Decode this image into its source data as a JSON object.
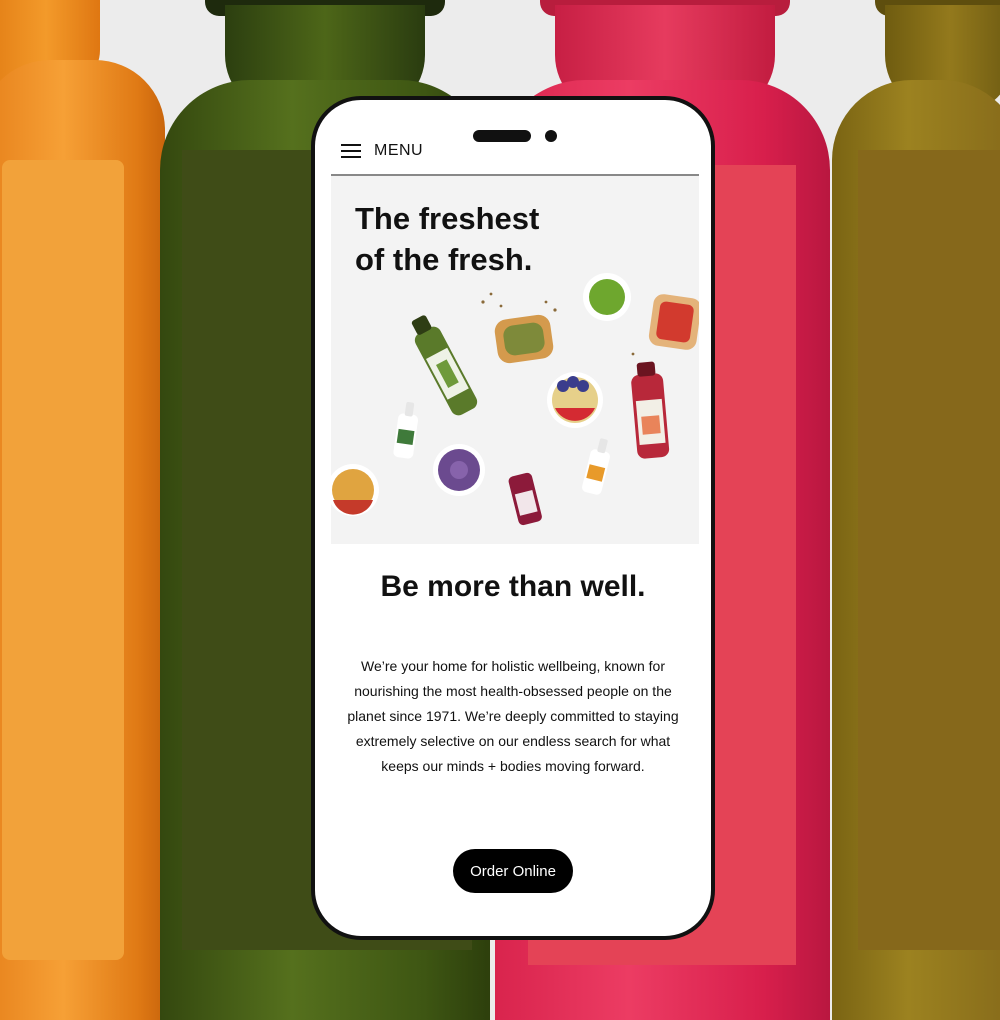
{
  "background": {
    "bottle_colors": [
      "#f39a2a",
      "#4d6618",
      "#e63b5e",
      "#93791c"
    ]
  },
  "header": {
    "menu_icon": "hamburger-icon",
    "menu_label": "MENU"
  },
  "hero": {
    "title_line1": "The freshest",
    "title_line2": "of the fresh.",
    "image_items": [
      "juice-bottle",
      "avocado-toast",
      "green-bowl",
      "strawberry-toast",
      "acai-bowl",
      "juice-bottle",
      "dropper-bottle",
      "smoothie-bowl",
      "juice-shot",
      "dropper-bottle",
      "fruit-bowl"
    ]
  },
  "main": {
    "tagline": "Be more than well.",
    "about": "We’re your home for holistic wellbeing, known for nourishing the most health-obsessed people on the planet since 1971. We’re deeply committed to staying extremely selective on our endless search for what keeps our minds + bodies moving forward.",
    "cta_label": "Order Online"
  },
  "colors": {
    "accent": "#000000",
    "text": "#111111",
    "hero_bg": "#f3f3f3"
  }
}
